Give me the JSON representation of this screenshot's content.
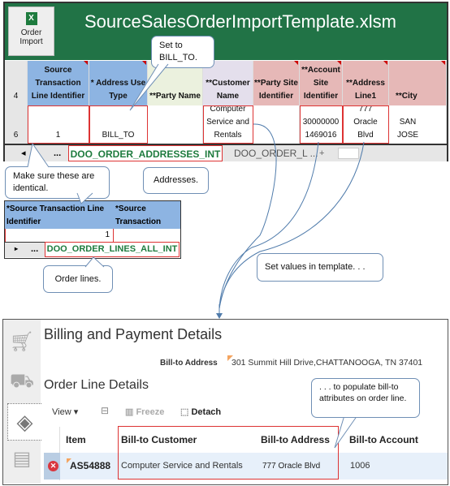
{
  "excel": {
    "title": "SourceSalesOrderImportTemplate.xlsm",
    "order_import": "Order Import",
    "header_row": "4",
    "data_row": "6",
    "columns": [
      "Source Transaction Line Identifier",
      "* Address Use Type",
      "**Party Name",
      "**Customer Name",
      "**Party Site Identifier",
      "**Account Site Identifier",
      "**Address Line1",
      "**City"
    ],
    "values": [
      "1",
      "BILL_TO",
      "",
      "Computer Service and Rentals",
      "",
      "30000000 1469016",
      "777 Oracle Blvd",
      "SAN JOSE"
    ],
    "tabs": {
      "more": "...",
      "active": "DOO_ORDER_ADDRESSES_INT",
      "other": "DOO_ORDER_L ...",
      "add": "+"
    }
  },
  "lines_sheet": {
    "columns": [
      "*Source Transaction Line Identifier",
      "*Source Transaction Identifier"
    ],
    "value": "1",
    "tabs": {
      "more": "...",
      "active": "DOO_ORDER_LINES_ALL_INT"
    }
  },
  "callouts": {
    "bill_to": "Set to BILL_TO.",
    "identical": "Make sure these are identical.",
    "addresses": "Addresses.",
    "order_lines": "Order lines.",
    "set_values": "Set values  in template. . .",
    "populate": ". . . to populate bill-to attributes on order line."
  },
  "app": {
    "billing_title": "Billing and Payment Details",
    "bill_to_label": "Bill-to Address",
    "bill_to_value": "301 Summit Hill Drive,CHATTANOOGA, TN 37401",
    "order_title": "Order Line Details",
    "toolbar": {
      "view": "View",
      "freeze": "Freeze",
      "detach": "Detach"
    },
    "columns": [
      "Item",
      "Bill-to Customer",
      "Bill-to Address",
      "Bill-to Account"
    ],
    "row": [
      "AS54888",
      "Computer Service and Rentals",
      "777 Oracle Blvd",
      "1006"
    ]
  },
  "colors": {
    "excel_green": "#217346",
    "header_blue": "#8db4e2",
    "header_pink": "#e6b8b7",
    "highlight": "#d33"
  }
}
